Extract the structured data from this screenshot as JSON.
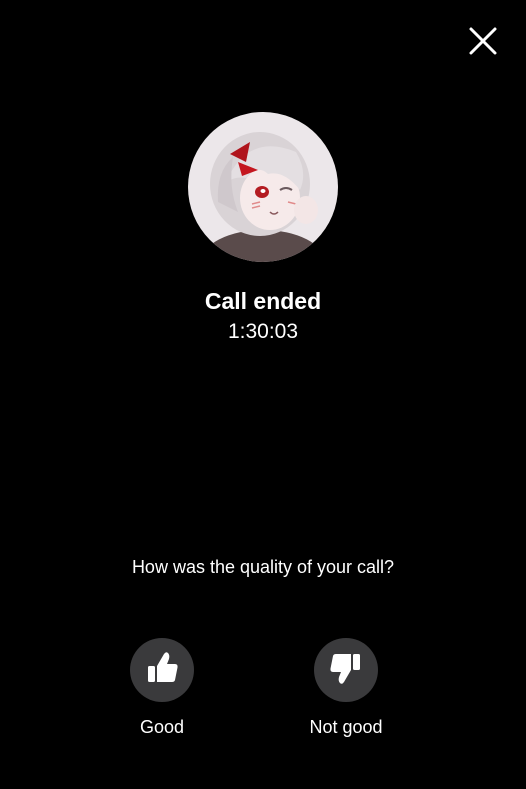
{
  "call": {
    "status": "Call ended",
    "duration": "1:30:03"
  },
  "feedback": {
    "question": "How was the quality of your call?",
    "good_label": "Good",
    "bad_label": "Not good"
  },
  "icons": {
    "close": "close-icon",
    "good": "thumbs-up-icon",
    "bad": "thumbs-down-icon"
  },
  "colors": {
    "background": "#000000",
    "text": "#ffffff",
    "button_circle": "#3a3a3c"
  }
}
